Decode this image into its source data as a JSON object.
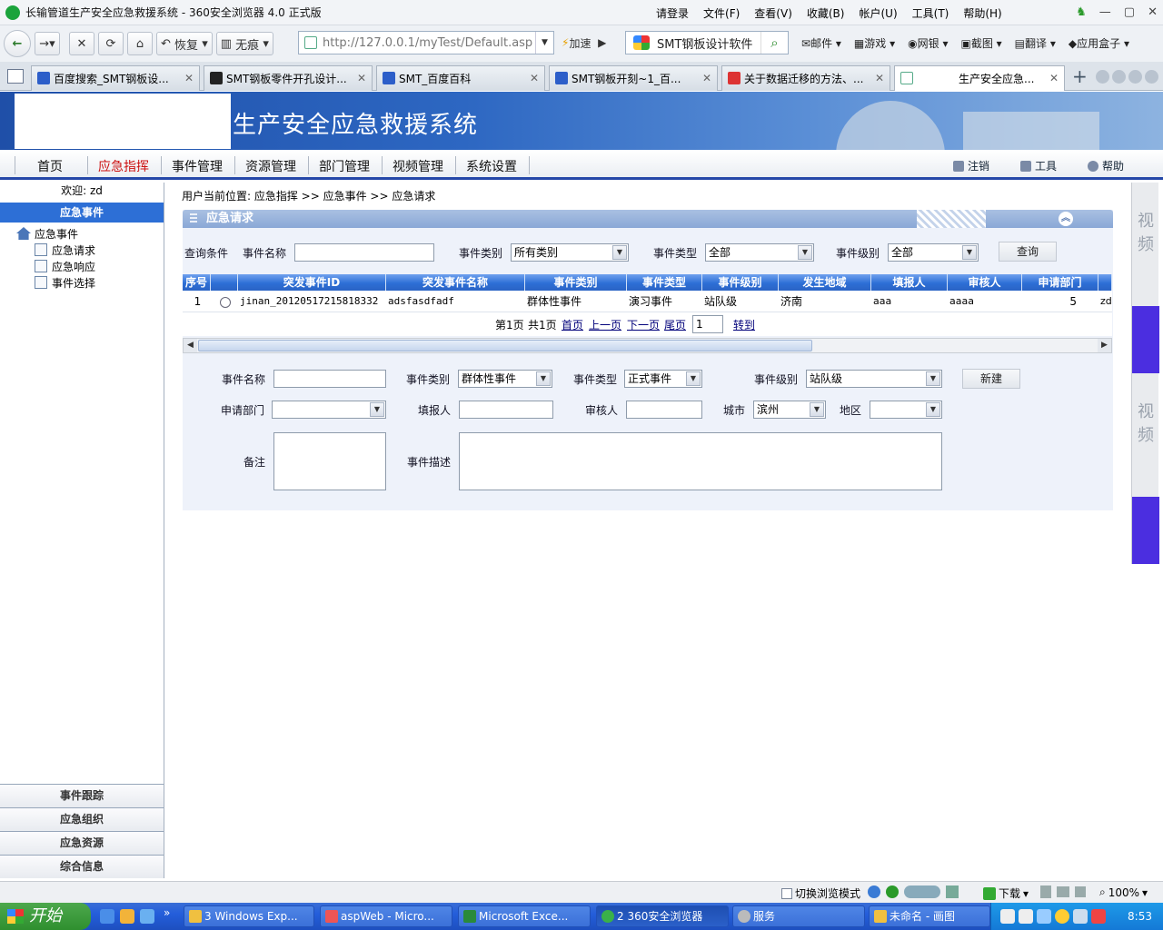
{
  "browser": {
    "title": "长输管道生产安全应急救援系统 - 360安全浏览器 4.0 正式版",
    "menus": [
      "请登录",
      "文件(F)",
      "查看(V)",
      "收藏(B)",
      "帐户(U)",
      "工具(T)",
      "帮助(H)"
    ],
    "restore_label": "恢复",
    "nomark_label": "无痕",
    "url": "http://127.0.0.1/myTest/Default.asp",
    "speed_label": "加速",
    "search_text": "SMT钢板设计软件",
    "tools": [
      "邮件",
      "游戏",
      "网银",
      "截图",
      "翻译",
      "应用盒子"
    ],
    "tabs": [
      {
        "label": "百度搜索_SMT钢板设..."
      },
      {
        "label": "SMT钢板零件开孔设计..."
      },
      {
        "label": "SMT_百度百科"
      },
      {
        "label": "SMT钢板开刻~1_百..."
      },
      {
        "label": "关于数据迁移的方法、..."
      },
      {
        "label": "生产安全应急..."
      }
    ],
    "status_items": [
      "切换浏览模式",
      "下载",
      "100%"
    ]
  },
  "app": {
    "system_title": "生产安全应急救援系统",
    "nav": [
      "首页",
      "应急指挥",
      "事件管理",
      "资源管理",
      "部门管理",
      "视频管理",
      "系统设置"
    ],
    "nav_active_index": 1,
    "nav_right": [
      "注销",
      "工具",
      "帮助"
    ],
    "welcome": "欢迎: zd",
    "left_header": "应急事件",
    "tree": {
      "root": "应急事件",
      "children": [
        "应急请求",
        "应急响应",
        "事件选择"
      ]
    },
    "left_bottom": [
      "事件跟踪",
      "应急组织",
      "应急资源",
      "综合信息"
    ],
    "right_strip": [
      "视频",
      "视频"
    ]
  },
  "main": {
    "breadcrumb": "用户当前位置: 应急指挥 >> 应急事件 >> 应急请求",
    "panel_title": "应急请求",
    "query": {
      "label": "查询条件",
      "name_label": "事件名称",
      "name_value": "",
      "category_label": "事件类别",
      "category_value": "所有类别",
      "type_label": "事件类型",
      "type_value": "全部",
      "level_label": "事件级别",
      "level_value": "全部",
      "search_button": "查询"
    },
    "table": {
      "columns": [
        "序号",
        "",
        "突发事件ID",
        "突发事件名称",
        "事件类别",
        "事件类型",
        "事件级别",
        "发生地域",
        "填报人",
        "审核人",
        "申请部门",
        ""
      ],
      "rows": [
        [
          "1",
          "",
          "jinan_20120517215818332",
          "adsfasdfadf",
          "群体性事件",
          "演习事件",
          "站队级",
          "济南",
          "aaa",
          "aaaa",
          "5",
          "zd"
        ]
      ]
    },
    "pager": {
      "current": "第1页",
      "total": "共1页",
      "first": "首页",
      "prev": "上一页",
      "next": "下一页",
      "last": "尾页",
      "page_input": "1",
      "go": "转到"
    },
    "form": {
      "name_label": "事件名称",
      "name_value": "",
      "category_label": "事件类别",
      "category_value": "群体性事件",
      "type_label": "事件类型",
      "type_value": "正式事件",
      "level_label": "事件级别",
      "level_value": "站队级",
      "new_button": "新建",
      "dept_label": "申请部门",
      "dept_value": "",
      "reporter_label": "填报人",
      "reporter_value": "",
      "reviewer_label": "审核人",
      "reviewer_value": "",
      "city_label": "城市",
      "city_value": "滨州",
      "area_label": "地区",
      "area_value": "",
      "remark_label": "备注",
      "desc_label": "事件描述"
    }
  },
  "taskbar": {
    "start": "开始",
    "items": [
      "3 Windows Exp...",
      "aspWeb - Micro...",
      "Microsoft Exce...",
      "2 360安全浏览器",
      "服务",
      "未命名 - 画图"
    ],
    "active_index": 3,
    "clock": "8:53"
  }
}
